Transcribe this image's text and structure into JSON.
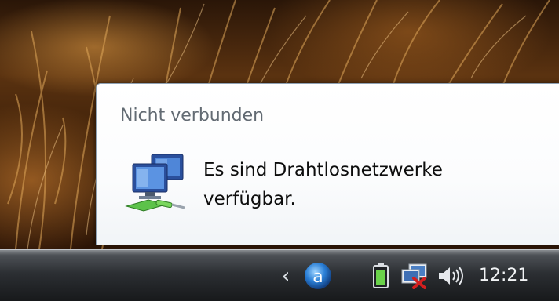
{
  "balloon": {
    "title": "Nicht verbunden",
    "message_line1": "Es sind Drahtlosnetzwerke",
    "message_line2": "verfügbar.",
    "icon": "wireless-network-icon"
  },
  "taskbar": {
    "clock": "12:21",
    "tray_icons": [
      "show-hidden-icons-chevron",
      "app-a-icon",
      "battery-icon",
      "network-disconnected-icon",
      "volume-icon"
    ],
    "app_icon_letter": "a"
  },
  "colors": {
    "balloon_title": "#636b73",
    "balloon_text": "#0d0d0d",
    "taskbar_text": "#f1f3f5",
    "error_red": "#d21f1f",
    "battery_green": "#6ad24a"
  }
}
